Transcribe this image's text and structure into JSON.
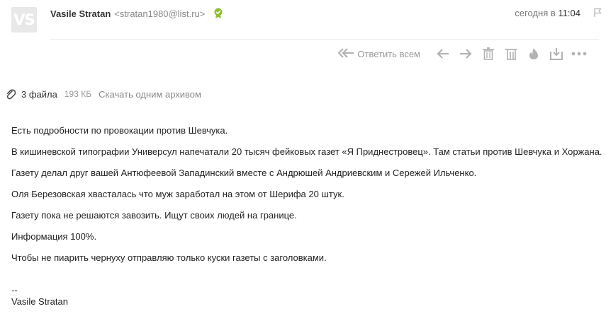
{
  "avatar": {
    "initials": "VS"
  },
  "sender": {
    "name": "Vasile Stratan",
    "email": "<stratan1980@list.ru>"
  },
  "date": {
    "day": "сегодня в",
    "time": "11:04"
  },
  "toolbar": {
    "reply_all_label": "Ответить всем"
  },
  "attachments": {
    "count_label": "3 файла",
    "size": "193 КБ",
    "download_label": "Скачать одним архивом"
  },
  "body": {
    "lines": [
      "Есть подробности по провокации против Шевчука.",
      "В кишиневской типографии Универсул напечатали 20 тысяч фейковых газет «Я Приднестровец». Там статьи против Шевчука и Хоржана.",
      "Газету делал друг вашей Антюфеевой Западинский вместе с Андрюшей Андриевским и Сережей Ильченко.",
      "Оля Березовская хвасталась что муж заработал на этом от Шерифа 20 штук.",
      "Газету пока не решаются завозить. Ищут своих людей на границе.",
      "Информация 100%.",
      "Чтобы не пиарить чернуху отправляю только куски газеты с заголовками."
    ]
  },
  "signature": {
    "dashes": "--",
    "name": "Vasile Stratan"
  },
  "colors": {
    "icon_gray": "#b3b3b3",
    "verified_green": "#8bbf2c"
  }
}
